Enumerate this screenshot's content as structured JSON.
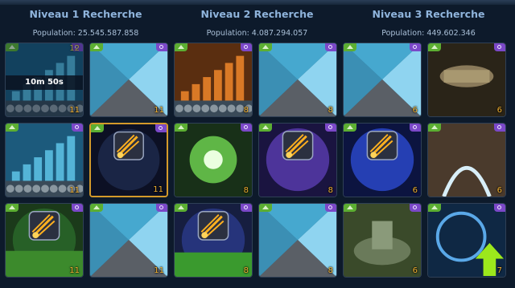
{
  "columns": [
    {
      "title": "Niveau 1 Recherche",
      "population": "Population: 25.545.587.858"
    },
    {
      "title": "Niveau 2 Recherche",
      "population": "Population: 4.087.294.057"
    },
    {
      "title": "Niveau 3 Recherche",
      "population": "Population: 449.602.346"
    }
  ],
  "tiles": [
    {
      "theme": "bars-teal",
      "count": "11",
      "top_count": "12",
      "timer": "10m 50s"
    },
    {
      "theme": "split-blue",
      "count": "11"
    },
    {
      "theme": "bars-orange",
      "count": "8"
    },
    {
      "theme": "split-blue",
      "count": "8"
    },
    {
      "theme": "split-blue",
      "count": "6"
    },
    {
      "theme": "ship",
      "count": "6"
    },
    {
      "theme": "bars-teal",
      "count": "11"
    },
    {
      "theme": "comet-dark",
      "count": "11",
      "selected": true
    },
    {
      "theme": "green-blast",
      "count": "8"
    },
    {
      "theme": "comet-purple",
      "count": "8"
    },
    {
      "theme": "comet-blue",
      "count": "6"
    },
    {
      "theme": "beam",
      "count": "6"
    },
    {
      "theme": "bars-green",
      "count": "11"
    },
    {
      "theme": "split-blue",
      "count": "11"
    },
    {
      "theme": "comet-green",
      "count": "8"
    },
    {
      "theme": "split-blue",
      "count": "8"
    },
    {
      "theme": "city",
      "count": "6"
    },
    {
      "theme": "compass",
      "count": "7"
    }
  ]
}
